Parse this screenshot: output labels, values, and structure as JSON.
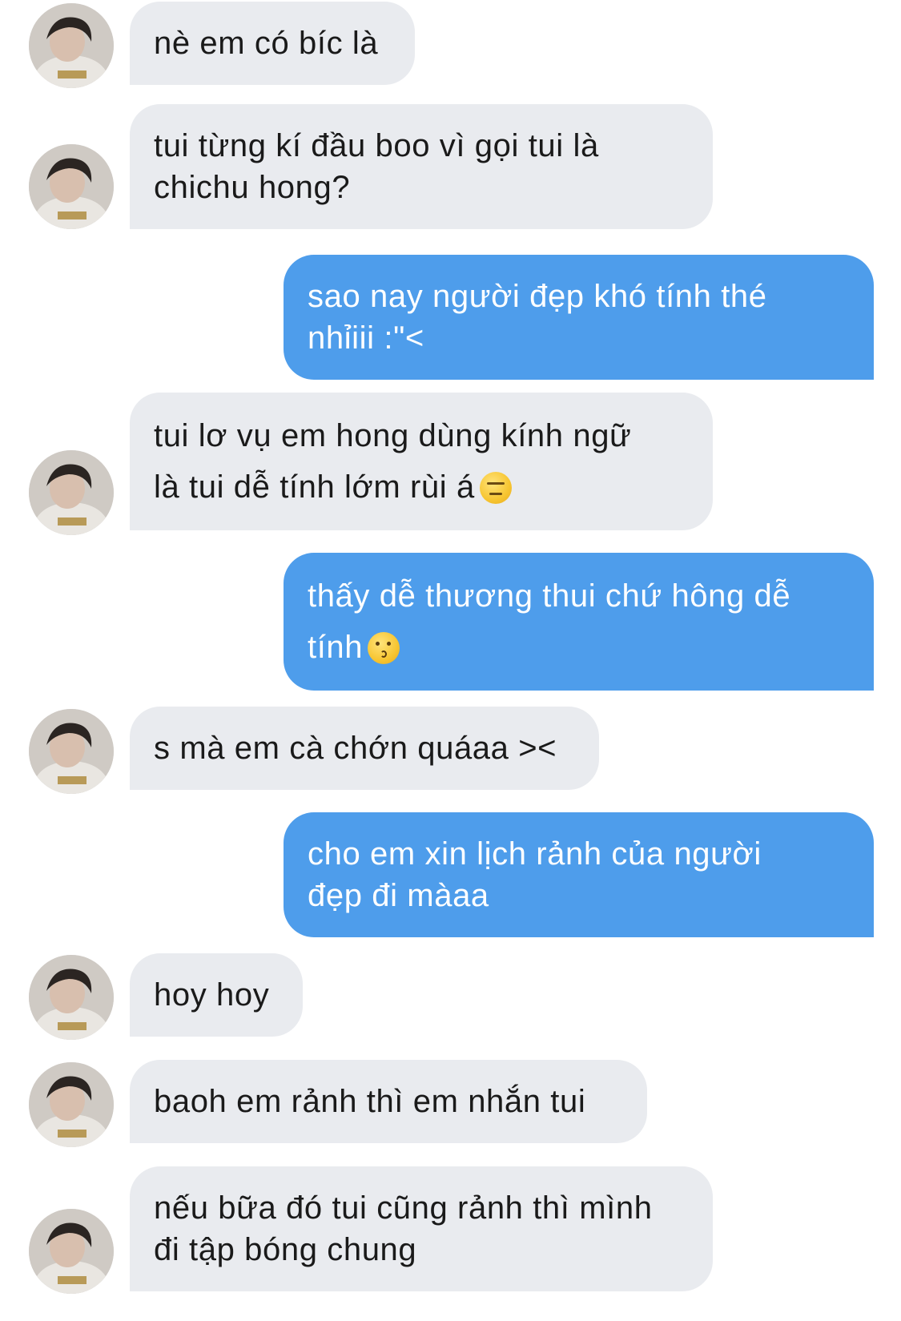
{
  "messages": [
    {
      "side": "in",
      "lines": [
        "nè em có bíc là"
      ]
    },
    {
      "side": "in",
      "lines": [
        "tui từng kí đầu boo vì gọi tui là",
        "chichu hong?"
      ]
    },
    {
      "side": "out",
      "lines": [
        "sao nay người đẹp khó tính thé",
        "nhỉiii :\"<"
      ]
    },
    {
      "side": "in",
      "lines": [
        "tui lơ vụ em hong dùng kính ngữ",
        "là tui dễ tính lớm rùi á"
      ],
      "emoji": "expressionless-face-icon"
    },
    {
      "side": "out",
      "lines": [
        "thấy dễ thương thui chứ hông dễ",
        "tính"
      ],
      "emoji": "kissing-face-icon"
    },
    {
      "side": "in",
      "lines": [
        "s mà em cà chớn quáaa ><"
      ]
    },
    {
      "side": "out",
      "lines": [
        "cho em xin lịch rảnh của người",
        "đẹp đi màaa"
      ]
    },
    {
      "side": "in",
      "lines": [
        "hoy hoy"
      ]
    },
    {
      "side": "in",
      "lines": [
        "baoh em rảnh thì em nhắn tui"
      ]
    },
    {
      "side": "in",
      "lines": [
        "nếu bữa đó tui cũng rảnh thì mình",
        "đi tập bóng chung"
      ]
    }
  ],
  "colors": {
    "incoming_bubble": "#e9ebef",
    "outgoing_bubble": "#4e9deb",
    "incoming_text": "#1a1a1a",
    "outgoing_text": "#ffffff"
  }
}
